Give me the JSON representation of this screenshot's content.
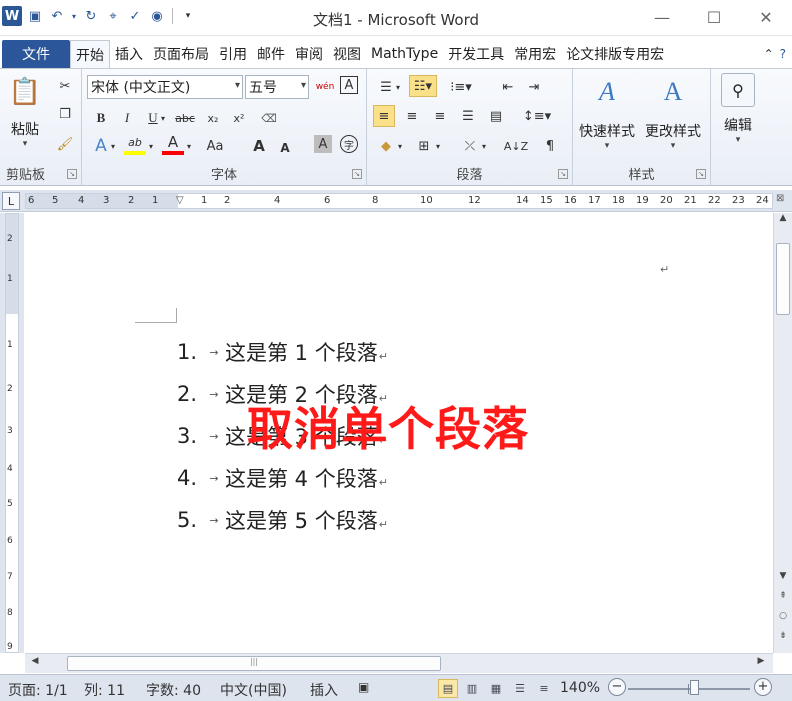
{
  "window": {
    "title": "文档1 - Microsoft Word",
    "controls": [
      "—",
      "☐",
      "✕"
    ]
  },
  "quick_access": {
    "logo": "W",
    "icons": [
      "save-icon",
      "undo-icon",
      "redo-icon",
      "format-painter-icon",
      "spelling-icon",
      "preview-icon",
      "customize-icon"
    ]
  },
  "ribbon_tabs": {
    "file": "文件",
    "tabs": [
      "开始",
      "插入",
      "页面布局",
      "引用",
      "邮件",
      "审阅",
      "视图",
      "MathType",
      "开发工具",
      "常用宏",
      "论文排版专用宏"
    ],
    "active": "开始"
  },
  "clipboard": {
    "paste_label": "粘贴",
    "group_label": "剪贴板"
  },
  "font": {
    "font_name": "宋体 (中文正文)",
    "font_size": "五号",
    "group_label": "字体",
    "bold": "B",
    "italic": "I",
    "underline": "U",
    "strike": "abc",
    "subscript": "x₂",
    "superscript": "x²",
    "grow": "A",
    "shrink": "A",
    "change_case": "Aa",
    "text_effect": "A",
    "highlight": "ab",
    "font_color": "A",
    "char_shading": "A",
    "enclose": "字",
    "phonetic": "wén",
    "char_border": "A",
    "colors": {
      "highlight": "#ffff00",
      "font_color": "#ff0000"
    }
  },
  "paragraph": {
    "group_label": "段落"
  },
  "styles": {
    "quick_styles": "快速样式",
    "change_styles": "更改样式",
    "group_label": "样式"
  },
  "editing": {
    "label": "编辑"
  },
  "ruler": {
    "corner": "L",
    "labels": [
      "6",
      "5",
      "4",
      "3",
      "2",
      "1",
      "1",
      "2",
      "4",
      "6",
      "8",
      "10",
      "12",
      "14",
      "15",
      "16",
      "17",
      "18",
      "19",
      "20",
      "21",
      "22",
      "23",
      "24"
    ]
  },
  "vruler": {
    "labels": [
      "2",
      "1",
      "1",
      "2",
      "3",
      "4",
      "5",
      "6",
      "7",
      "8",
      "9"
    ]
  },
  "document": {
    "list": [
      {
        "num": "1.",
        "text": "这是第 1 个段落"
      },
      {
        "num": "2.",
        "text": "这是第 2 个段落"
      },
      {
        "num": "3.",
        "text": "这是第 3 个段落"
      },
      {
        "num": "4.",
        "text": "这是第 4 个段落"
      },
      {
        "num": "5.",
        "text": "这是第 5 个段落"
      }
    ],
    "tab_arrow": "→",
    "para_mark": "↵",
    "overlay": "取消单个段落",
    "overlay_color": "#ff1a1a"
  },
  "statusbar": {
    "page": "页面: 1/1",
    "column": "列: 11",
    "words": "字数: 40",
    "language": "中文(中国)",
    "insert": "插入",
    "zoom": "140%",
    "zoom_value": 1.4
  }
}
